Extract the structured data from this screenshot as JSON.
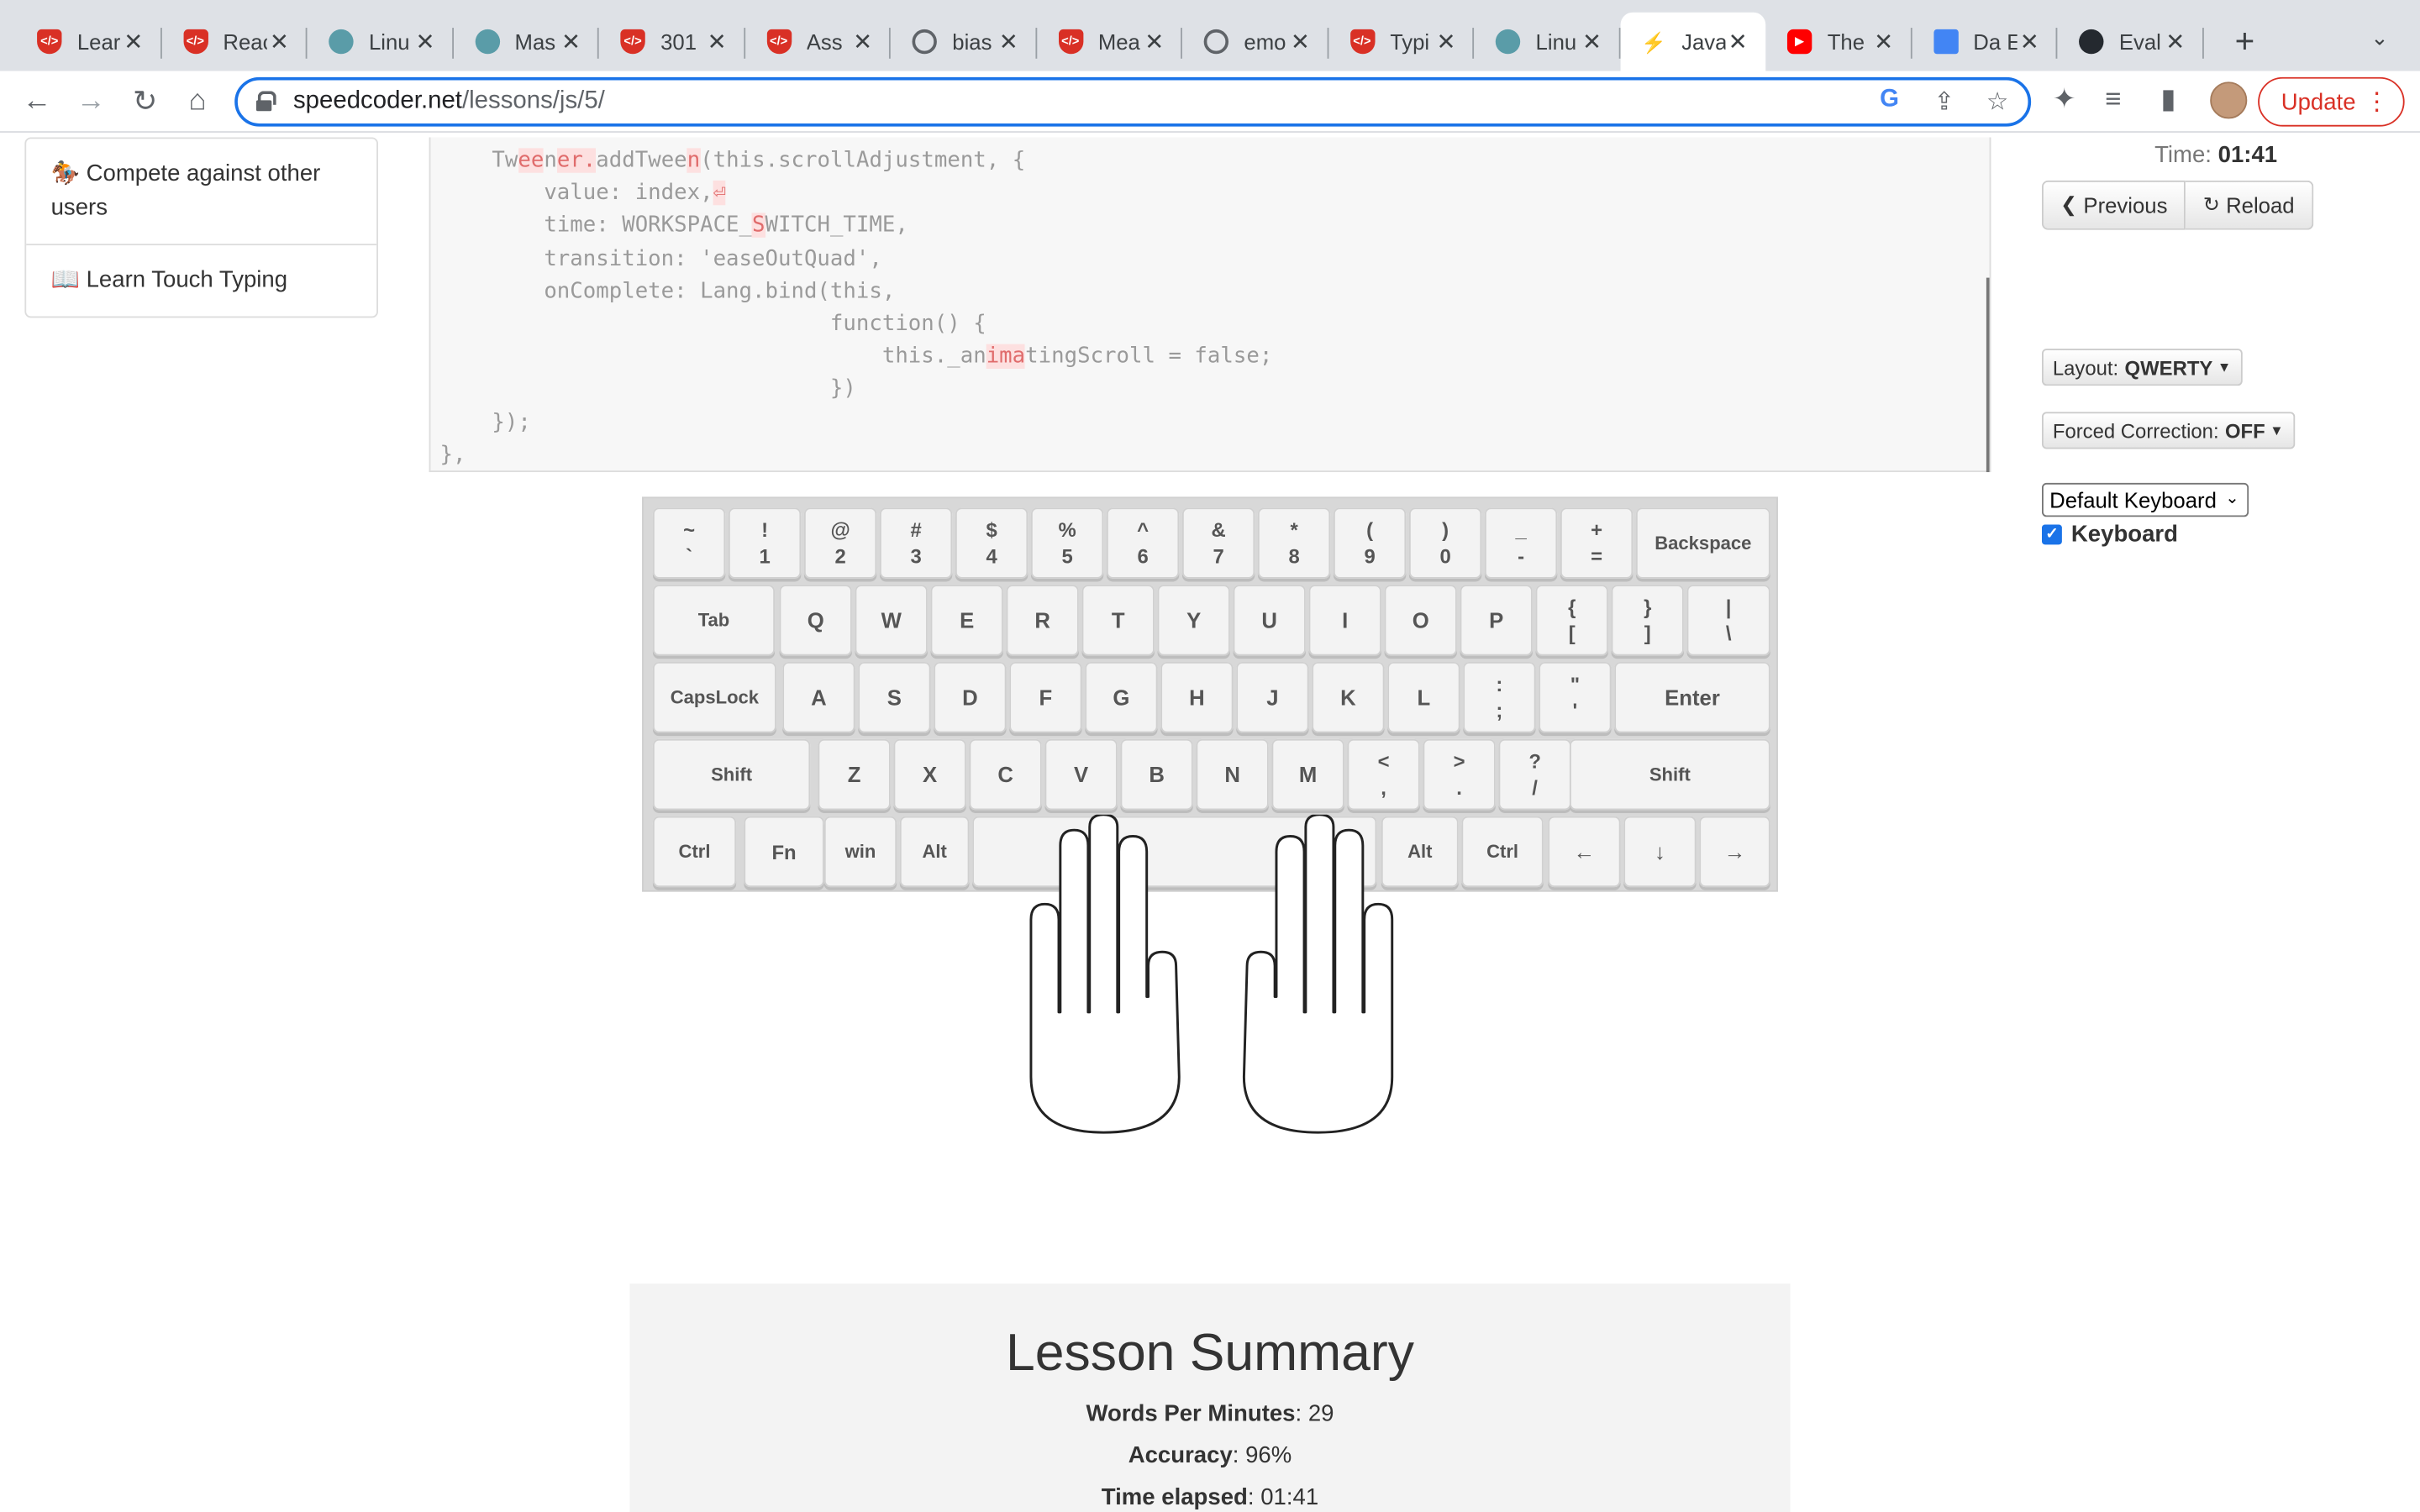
{
  "browser": {
    "tabs": [
      {
        "title": "Lear",
        "favicon": "shield"
      },
      {
        "title": "Reac",
        "favicon": "shield"
      },
      {
        "title": "Linu",
        "favicon": "dot"
      },
      {
        "title": "Mas",
        "favicon": "dot"
      },
      {
        "title": "301",
        "favicon": "shield"
      },
      {
        "title": "Ass",
        "favicon": "shield"
      },
      {
        "title": "bias",
        "favicon": "globe"
      },
      {
        "title": "Mea",
        "favicon": "shield"
      },
      {
        "title": "emo",
        "favicon": "globe"
      },
      {
        "title": "Typi",
        "favicon": "shield"
      },
      {
        "title": "Linu",
        "favicon": "dot"
      },
      {
        "title": "Java",
        "favicon": "bolt",
        "active": true
      },
      {
        "title": "The",
        "favicon": "youtube"
      },
      {
        "title": "Da E",
        "favicon": "docs"
      },
      {
        "title": "Eval",
        "favicon": "github"
      }
    ],
    "url_host": "speedcoder.net",
    "url_path": "/lessons/js/5/",
    "update_label": "Update"
  },
  "sidebar": {
    "items": [
      {
        "icon": "🏇",
        "label": "Compete against other users"
      },
      {
        "icon": "📖",
        "label": "Learn Touch Typing"
      }
    ]
  },
  "code": {
    "lines": [
      [
        {
          "t": "    Tw"
        },
        {
          "t": "ee",
          "e": true
        },
        {
          "t": "n"
        },
        {
          "t": "er.",
          "e": true
        },
        {
          "t": "addTwee"
        },
        {
          "t": "n",
          "e": true
        },
        {
          "t": "(this.scrollAdjustment, {"
        }
      ],
      [
        {
          "t": "        value: index,"
        },
        {
          "t": "⏎",
          "e": true
        }
      ],
      [
        {
          "t": "        time: WORKSPACE_"
        },
        {
          "t": "S",
          "e": true
        },
        {
          "t": "WITCH_TIME,"
        }
      ],
      [
        {
          "t": "        transition: 'easeOutQuad',"
        }
      ],
      [
        {
          "t": "        onComplete: Lang.bind(this,"
        }
      ],
      [
        {
          "t": "                              function() {"
        }
      ],
      [
        {
          "t": "                                  this._an"
        },
        {
          "t": "ima",
          "e": true
        },
        {
          "t": "tingScroll = false;"
        }
      ],
      [
        {
          "t": "                              })"
        }
      ],
      [
        {
          "t": "    });"
        }
      ],
      [
        {
          "t": "},"
        }
      ]
    ]
  },
  "controls": {
    "time_label": "Time:",
    "time_value": "01:41",
    "previous_label": "Previous",
    "reload_label": "Reload",
    "layout_label": "Layout:",
    "layout_value": "QWERTY",
    "forced_label": "Forced Correction:",
    "forced_value": "OFF",
    "keyboard_select": "Default Keyboard",
    "keyboard_checkbox_label": "Keyboard",
    "keyboard_checked": true
  },
  "keyboard": {
    "rows": [
      [
        [
          "~",
          "`"
        ],
        [
          "!",
          "1"
        ],
        [
          "@",
          "2"
        ],
        [
          "#",
          "3"
        ],
        [
          "$",
          "4"
        ],
        [
          "%",
          "5"
        ],
        [
          "^",
          "6"
        ],
        [
          "&",
          "7"
        ],
        [
          "*",
          "8"
        ],
        [
          "(",
          "9"
        ],
        [
          ")",
          "0"
        ],
        [
          "_",
          "-"
        ],
        [
          "+",
          "="
        ],
        [
          "Backspace"
        ]
      ],
      [
        [
          "Tab"
        ],
        [
          "Q"
        ],
        [
          "W"
        ],
        [
          "E"
        ],
        [
          "R"
        ],
        [
          "T"
        ],
        [
          "Y"
        ],
        [
          "U"
        ],
        [
          "I"
        ],
        [
          "O"
        ],
        [
          "P"
        ],
        [
          "{",
          "["
        ],
        [
          "}",
          "]"
        ],
        [
          "|",
          "\\"
        ]
      ],
      [
        [
          "CapsLock"
        ],
        [
          "A"
        ],
        [
          "S"
        ],
        [
          "D"
        ],
        [
          "F"
        ],
        [
          "G"
        ],
        [
          "H"
        ],
        [
          "J"
        ],
        [
          "K"
        ],
        [
          "L"
        ],
        [
          ":",
          ";"
        ],
        [
          "\"",
          "'"
        ],
        [
          "Enter"
        ]
      ],
      [
        [
          "Shift"
        ],
        [
          "Z"
        ],
        [
          "X"
        ],
        [
          "C"
        ],
        [
          "V"
        ],
        [
          "B"
        ],
        [
          "N"
        ],
        [
          "M"
        ],
        [
          "<",
          ","
        ],
        [
          ">",
          "."
        ],
        [
          "?",
          "/"
        ],
        [
          "Shift"
        ]
      ],
      [
        [
          "Ctrl"
        ],
        [
          "Fn"
        ],
        [
          "win"
        ],
        [
          "Alt"
        ],
        [
          ""
        ],
        [
          "Alt"
        ],
        [
          "Ctrl"
        ],
        [
          "←"
        ],
        [
          "↓"
        ],
        [
          "→"
        ]
      ]
    ]
  },
  "summary": {
    "title": "Lesson Summary",
    "wpm_label": "Words Per Minutes",
    "wpm_value": "29",
    "accuracy_label": "Accuracy",
    "accuracy_value": "96%",
    "elapsed_label": "Time elapsed",
    "elapsed_value": "01:41"
  }
}
